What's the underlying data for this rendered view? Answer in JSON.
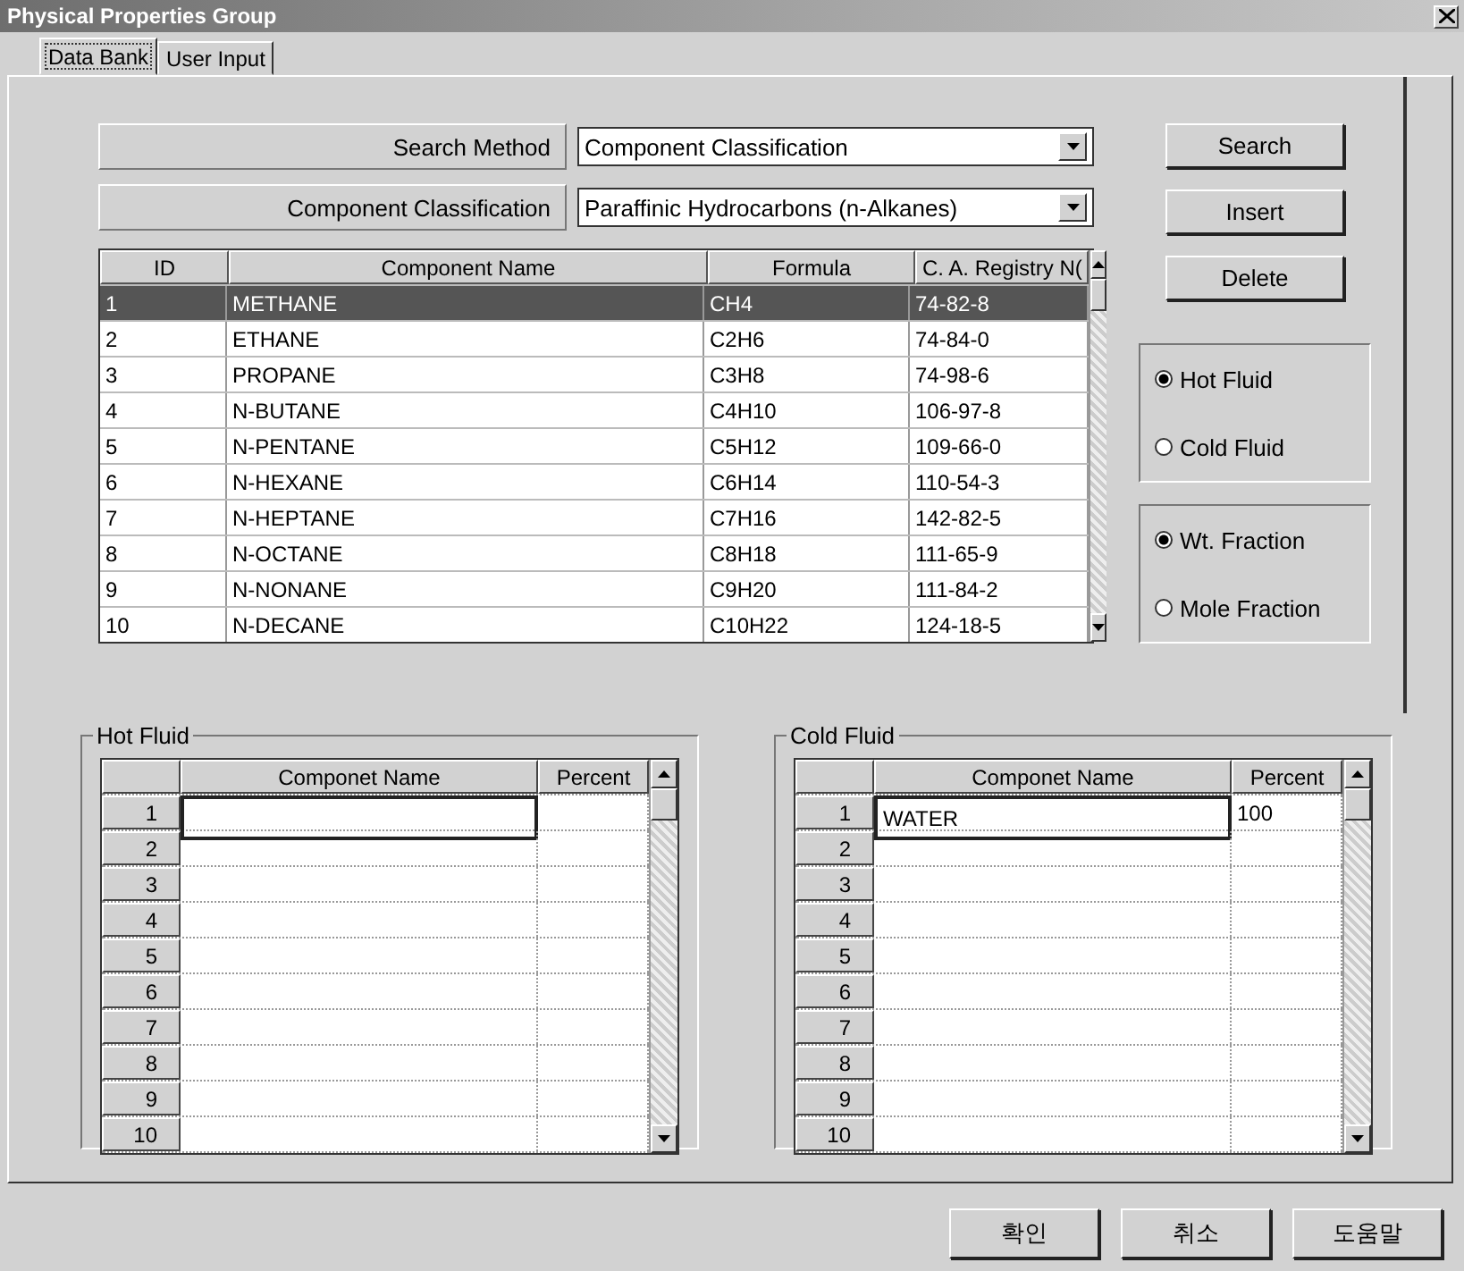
{
  "window": {
    "title": "Physical Properties Group"
  },
  "tabs": [
    {
      "label": "Data Bank",
      "selected": true
    },
    {
      "label": "User Input",
      "selected": false
    }
  ],
  "search_method": {
    "label": "Search Method",
    "value": "Component Classification"
  },
  "component_classification": {
    "label": "Component Classification",
    "value": "Paraffinic Hydrocarbons (n-Alkanes)"
  },
  "action_buttons": [
    "Search",
    "Insert",
    "Delete"
  ],
  "components_table": {
    "columns": [
      "ID",
      "Component Name",
      "Formula",
      "C. A. Registry N("
    ],
    "rows": [
      {
        "cells": [
          "1",
          "METHANE",
          "CH4",
          "74-82-8"
        ],
        "selected": true
      },
      {
        "cells": [
          "2",
          "ETHANE",
          "C2H6",
          "74-84-0"
        ],
        "selected": false
      },
      {
        "cells": [
          "3",
          "PROPANE",
          "C3H8",
          "74-98-6"
        ],
        "selected": false
      },
      {
        "cells": [
          "4",
          "N-BUTANE",
          "C4H10",
          "106-97-8"
        ],
        "selected": false
      },
      {
        "cells": [
          "5",
          "N-PENTANE",
          "C5H12",
          "109-66-0"
        ],
        "selected": false
      },
      {
        "cells": [
          "6",
          "N-HEXANE",
          "C6H14",
          "110-54-3"
        ],
        "selected": false
      },
      {
        "cells": [
          "7",
          "N-HEPTANE",
          "C7H16",
          "142-82-5"
        ],
        "selected": false
      },
      {
        "cells": [
          "8",
          "N-OCTANE",
          "C8H18",
          "111-65-9"
        ],
        "selected": false
      },
      {
        "cells": [
          "9",
          "N-NONANE",
          "C9H20",
          "111-84-2"
        ],
        "selected": false
      },
      {
        "cells": [
          "10",
          "N-DECANE",
          "C10H22",
          "124-18-5"
        ],
        "selected": false
      }
    ]
  },
  "fluid_options": [
    {
      "label": "Hot Fluid",
      "selected": true
    },
    {
      "label": "Cold Fluid",
      "selected": false
    }
  ],
  "fraction_options": [
    {
      "label": "Wt. Fraction",
      "selected": true
    },
    {
      "label": "Mole Fraction",
      "selected": false
    }
  ],
  "fluid_grids": [
    {
      "title": "Hot Fluid",
      "columns": [
        "Componet Name",
        "Percent"
      ],
      "rows": [
        {
          "number": "1",
          "active": true
        },
        {
          "number": "2",
          "active": false
        },
        {
          "number": "3",
          "active": false
        },
        {
          "number": "4",
          "active": false
        },
        {
          "number": "5",
          "active": false
        },
        {
          "number": "6",
          "active": false
        },
        {
          "number": "7",
          "active": false
        },
        {
          "number": "8",
          "active": false
        },
        {
          "number": "9",
          "active": false
        },
        {
          "number": "10",
          "active": false
        }
      ]
    },
    {
      "title": "Cold Fluid",
      "columns": [
        "Componet Name",
        "Percent"
      ],
      "rows": [
        {
          "number": "1",
          "name": "WATER",
          "percent": "100",
          "active": true
        },
        {
          "number": "2",
          "active": false
        },
        {
          "number": "3",
          "active": false
        },
        {
          "number": "4",
          "active": false
        },
        {
          "number": "5",
          "active": false
        },
        {
          "number": "6",
          "active": false
        },
        {
          "number": "7",
          "active": false
        },
        {
          "number": "8",
          "active": false
        },
        {
          "number": "9",
          "active": false
        },
        {
          "number": "10",
          "active": false
        }
      ]
    }
  ],
  "dialog_buttons": [
    "확인",
    "취소",
    "도움말"
  ]
}
